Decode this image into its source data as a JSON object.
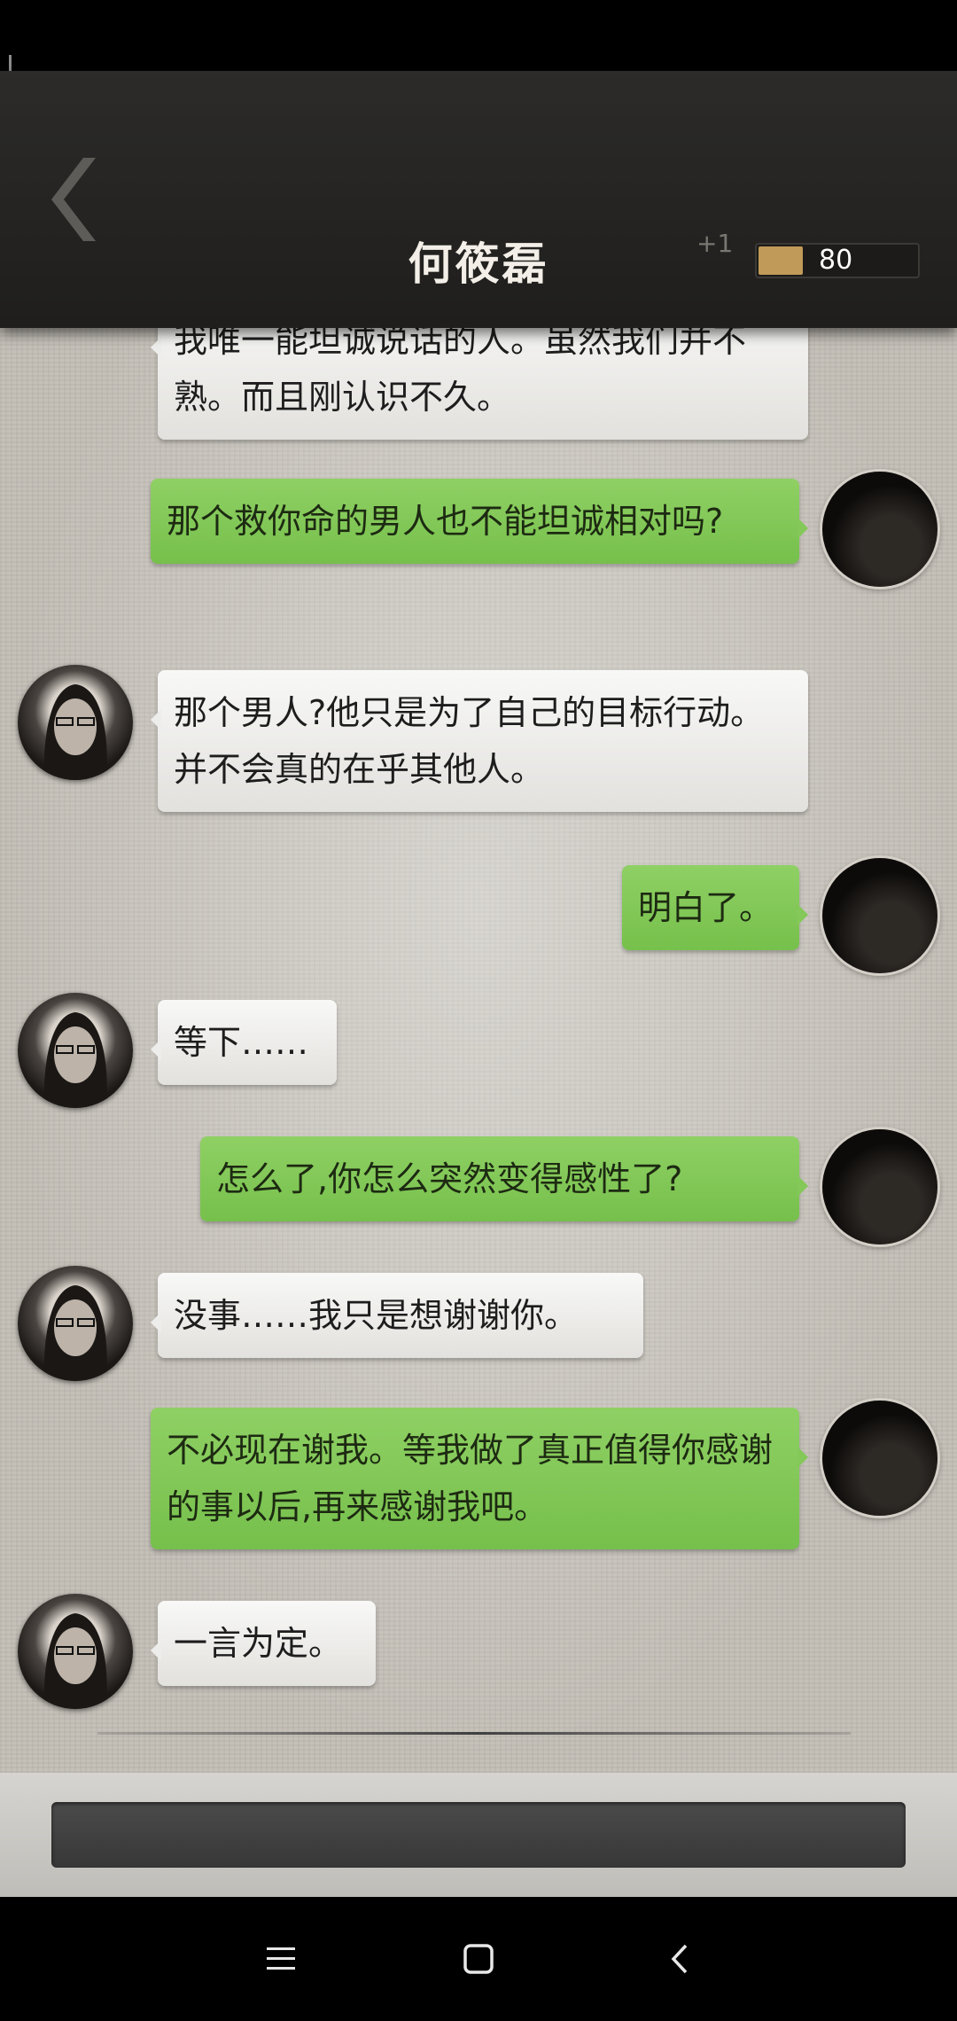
{
  "header": {
    "title": "何筱磊",
    "increment": "+1",
    "score": "80",
    "score_fraction": 0.28,
    "score_color": "#c09a58"
  },
  "messages": [
    {
      "side": "left",
      "text": "我唯一能坦诚说话的人。虽然我们并不熟。而且刚认识不久。",
      "avatar": "npc-portrait"
    },
    {
      "side": "right",
      "text": "那个救你命的男人也不能坦诚相对吗?",
      "avatar": "player-portrait"
    },
    {
      "side": "left",
      "text": "那个男人?他只是为了自己的目标行动。并不会真的在乎其他人。",
      "avatar": "npc-portrait"
    },
    {
      "side": "right",
      "text": "明白了。",
      "avatar": "player-portrait"
    },
    {
      "side": "left",
      "text": "等下……",
      "avatar": "npc-portrait"
    },
    {
      "side": "right",
      "text": "怎么了,你怎么突然变得感性了?",
      "avatar": "player-portrait"
    },
    {
      "side": "left",
      "text": "没事……我只是想谢谢你。",
      "avatar": "npc-portrait"
    },
    {
      "side": "right",
      "text": "不必现在谢我。等我做了真正值得你感谢的事以后,再来感谢我吧。",
      "avatar": "player-portrait"
    },
    {
      "side": "left",
      "text": "一言为定。",
      "avatar": "npc-portrait"
    }
  ],
  "input": {
    "value": "",
    "placeholder": ""
  },
  "colors": {
    "left_bubble": "#efeeeb",
    "right_bubble": "#82c657",
    "header": "#252422"
  },
  "navbar": {
    "icons": [
      "menu-icon",
      "home-square-icon",
      "back-chevron-icon"
    ]
  }
}
